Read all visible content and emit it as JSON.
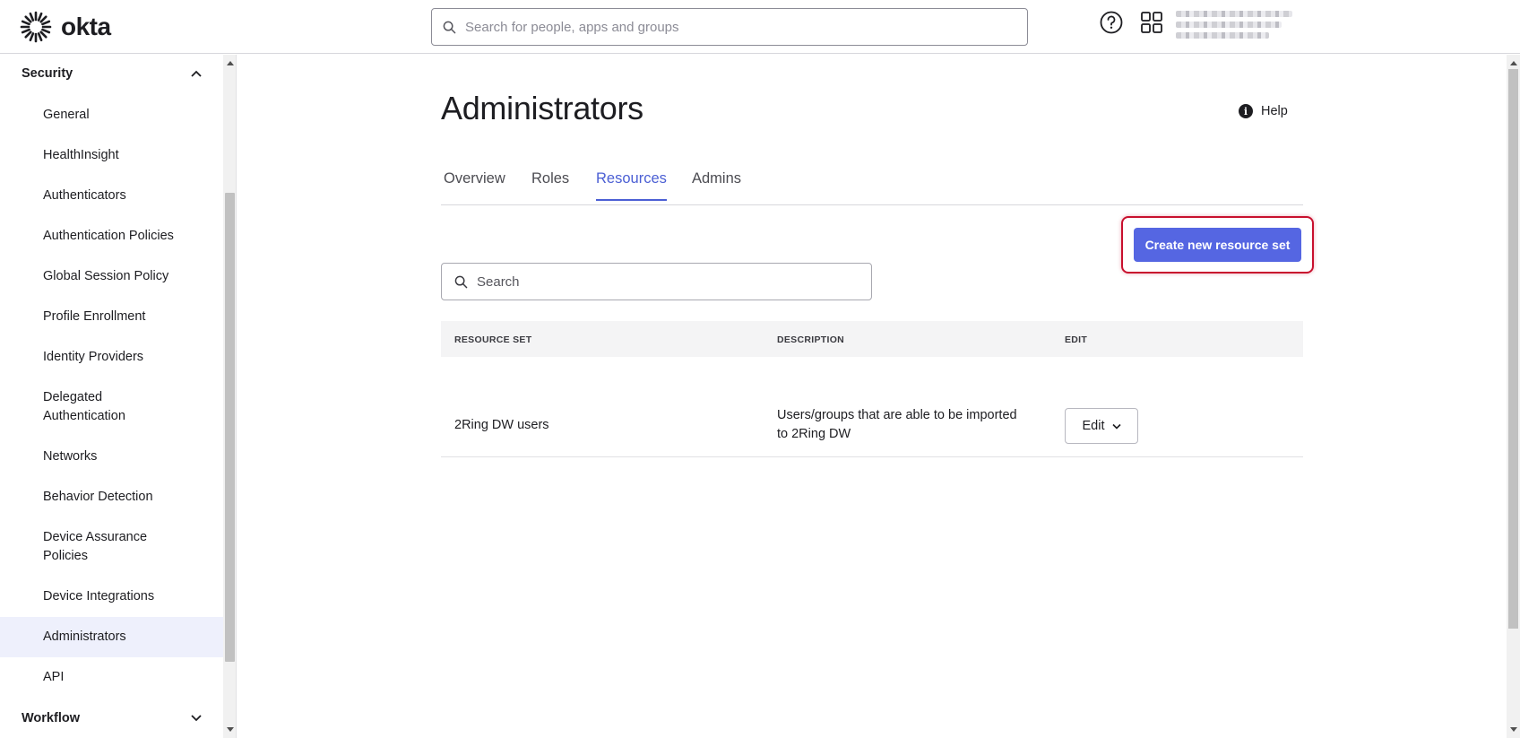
{
  "app": {
    "logo_text": "okta"
  },
  "header": {
    "search_placeholder": "Search for people, apps and groups",
    "icons": [
      "search-icon",
      "help-icon",
      "apps-grid-icon"
    ]
  },
  "sidebar": {
    "sections": [
      {
        "label": "Security",
        "expanded": true
      },
      {
        "label": "Workflow",
        "expanded": false
      }
    ],
    "items": [
      {
        "label": "General"
      },
      {
        "label": "HealthInsight"
      },
      {
        "label": "Authenticators"
      },
      {
        "label": "Authentication Policies"
      },
      {
        "label": "Global Session Policy"
      },
      {
        "label": "Profile Enrollment"
      },
      {
        "label": "Identity Providers"
      },
      {
        "label": "Delegated Authentication"
      },
      {
        "label": "Networks"
      },
      {
        "label": "Behavior Detection"
      },
      {
        "label": "Device Assurance Policies"
      },
      {
        "label": "Device Integrations"
      },
      {
        "label": "Administrators",
        "active": true
      },
      {
        "label": "API"
      }
    ]
  },
  "main": {
    "title": "Administrators",
    "help_label": "Help",
    "tabs": [
      {
        "label": "Overview"
      },
      {
        "label": "Roles"
      },
      {
        "label": "Resources",
        "active": true
      },
      {
        "label": "Admins"
      }
    ],
    "create_button_label": "Create new resource set",
    "search_placeholder": "Search",
    "table": {
      "columns": [
        "RESOURCE SET",
        "DESCRIPTION",
        "EDIT"
      ],
      "rows": [
        {
          "resource_set": "2Ring DW users",
          "description_line1": "Users/groups that are able to be imported",
          "description_line2": "to 2Ring DW",
          "edit_label": "Edit"
        }
      ]
    }
  },
  "colors": {
    "accent": "#5566e2",
    "active_tab": "#4b5fd4",
    "highlight_border": "#c8102e",
    "active_nav_bg": "#eef0fc"
  }
}
